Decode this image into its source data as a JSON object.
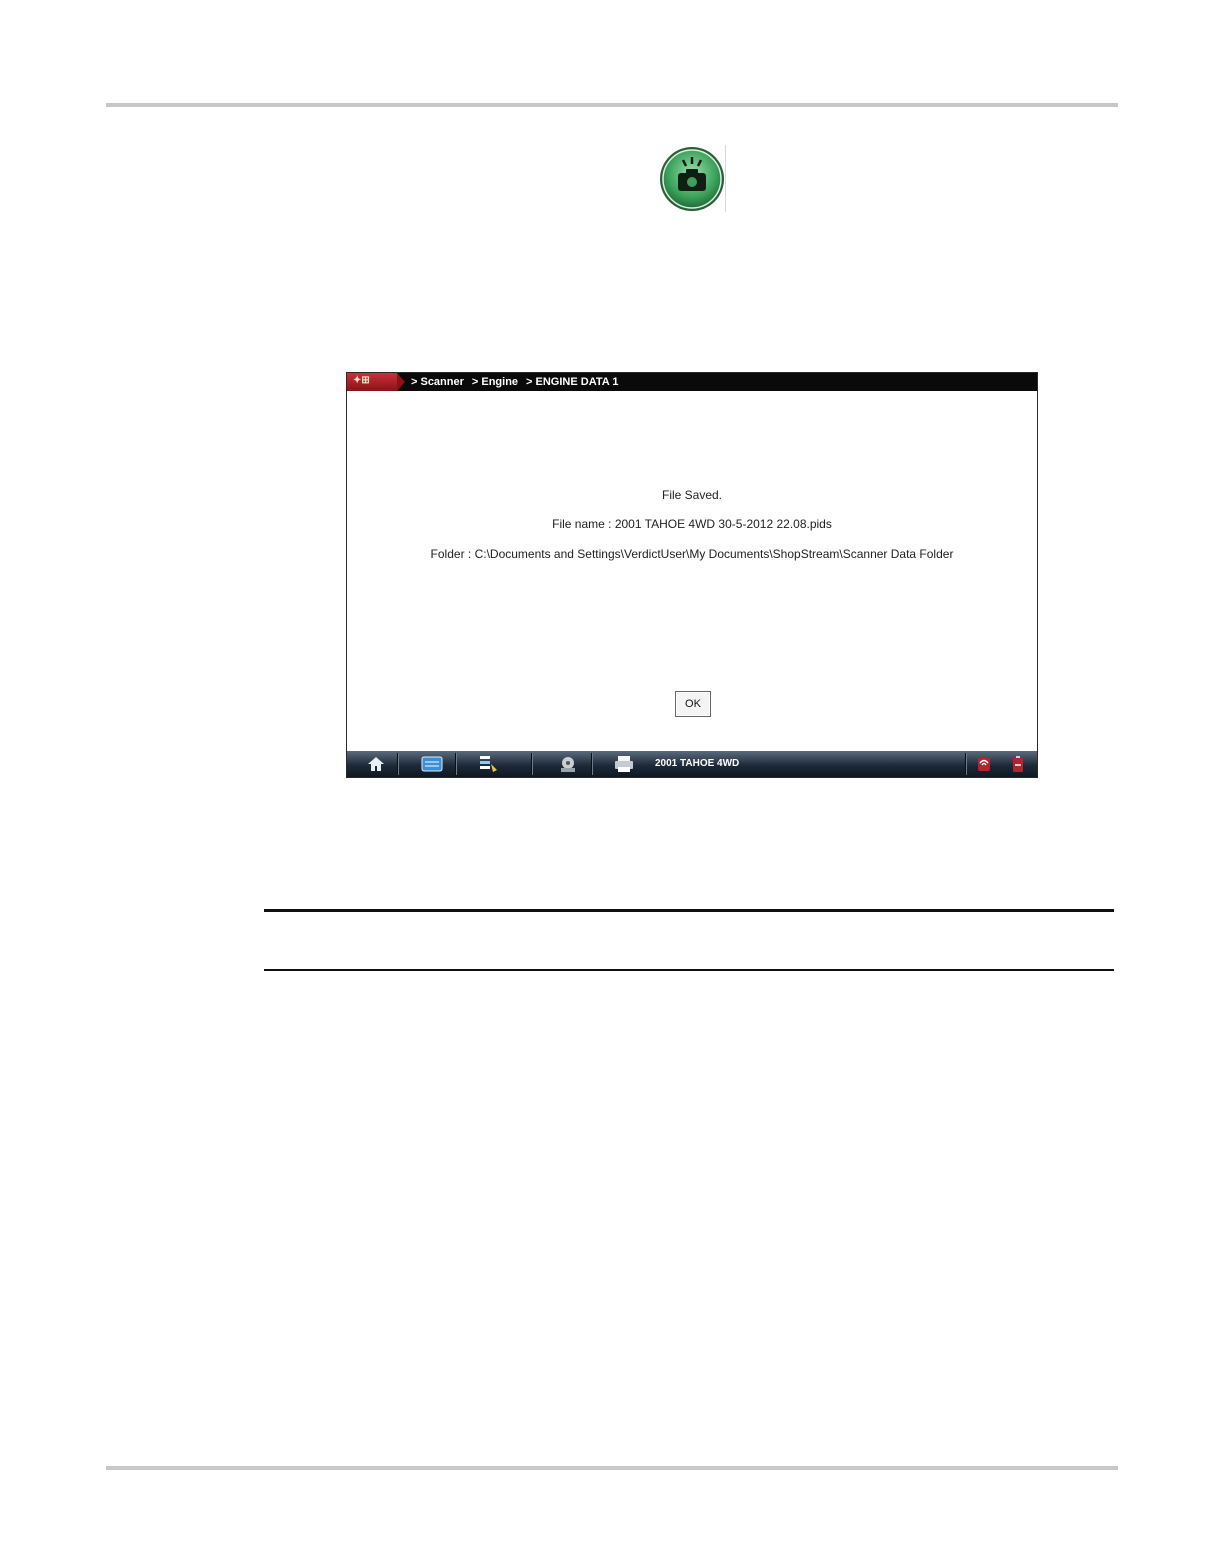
{
  "screen": {
    "breadcrumb": [
      "> Scanner",
      "> Engine",
      "> ENGINE DATA 1"
    ],
    "dialog": {
      "line1": "File Saved.",
      "line2": "File name : 2001 TAHOE 4WD 30-5-2012 22.08.pids",
      "line3": "Folder : C:\\Documents and Settings\\VerdictUser\\My Documents\\ShopStream\\Scanner Data Folder",
      "ok_label": "OK"
    },
    "taskbar": {
      "vehicle_label": "2001 TAHOE 4WD",
      "icons": [
        "home-icon",
        "scanner-icon",
        "save-data-icon",
        "vehicle-icon",
        "print-icon",
        "connection-icon",
        "battery-icon"
      ]
    }
  },
  "colors": {
    "camera_icon_green": "#3aa05a",
    "titlebar": "#0a0a0a",
    "logo_red": "#b3242c"
  }
}
